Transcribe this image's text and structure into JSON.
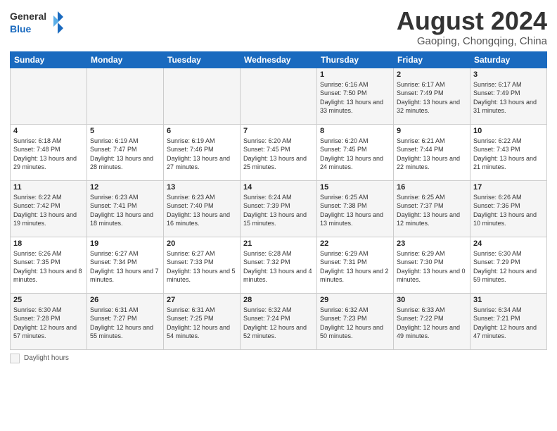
{
  "header": {
    "logo_general": "General",
    "logo_blue": "Blue",
    "month_title": "August 2024",
    "location": "Gaoping, Chongqing, China"
  },
  "days_of_week": [
    "Sunday",
    "Monday",
    "Tuesday",
    "Wednesday",
    "Thursday",
    "Friday",
    "Saturday"
  ],
  "legend": {
    "label": "Daylight hours"
  },
  "weeks": [
    [
      {
        "day": "",
        "info": ""
      },
      {
        "day": "",
        "info": ""
      },
      {
        "day": "",
        "info": ""
      },
      {
        "day": "",
        "info": ""
      },
      {
        "day": "1",
        "info": "Sunrise: 6:16 AM\nSunset: 7:50 PM\nDaylight: 13 hours\nand 33 minutes."
      },
      {
        "day": "2",
        "info": "Sunrise: 6:17 AM\nSunset: 7:49 PM\nDaylight: 13 hours\nand 32 minutes."
      },
      {
        "day": "3",
        "info": "Sunrise: 6:17 AM\nSunset: 7:49 PM\nDaylight: 13 hours\nand 31 minutes."
      }
    ],
    [
      {
        "day": "4",
        "info": "Sunrise: 6:18 AM\nSunset: 7:48 PM\nDaylight: 13 hours\nand 29 minutes."
      },
      {
        "day": "5",
        "info": "Sunrise: 6:19 AM\nSunset: 7:47 PM\nDaylight: 13 hours\nand 28 minutes."
      },
      {
        "day": "6",
        "info": "Sunrise: 6:19 AM\nSunset: 7:46 PM\nDaylight: 13 hours\nand 27 minutes."
      },
      {
        "day": "7",
        "info": "Sunrise: 6:20 AM\nSunset: 7:45 PM\nDaylight: 13 hours\nand 25 minutes."
      },
      {
        "day": "8",
        "info": "Sunrise: 6:20 AM\nSunset: 7:45 PM\nDaylight: 13 hours\nand 24 minutes."
      },
      {
        "day": "9",
        "info": "Sunrise: 6:21 AM\nSunset: 7:44 PM\nDaylight: 13 hours\nand 22 minutes."
      },
      {
        "day": "10",
        "info": "Sunrise: 6:22 AM\nSunset: 7:43 PM\nDaylight: 13 hours\nand 21 minutes."
      }
    ],
    [
      {
        "day": "11",
        "info": "Sunrise: 6:22 AM\nSunset: 7:42 PM\nDaylight: 13 hours\nand 19 minutes."
      },
      {
        "day": "12",
        "info": "Sunrise: 6:23 AM\nSunset: 7:41 PM\nDaylight: 13 hours\nand 18 minutes."
      },
      {
        "day": "13",
        "info": "Sunrise: 6:23 AM\nSunset: 7:40 PM\nDaylight: 13 hours\nand 16 minutes."
      },
      {
        "day": "14",
        "info": "Sunrise: 6:24 AM\nSunset: 7:39 PM\nDaylight: 13 hours\nand 15 minutes."
      },
      {
        "day": "15",
        "info": "Sunrise: 6:25 AM\nSunset: 7:38 PM\nDaylight: 13 hours\nand 13 minutes."
      },
      {
        "day": "16",
        "info": "Sunrise: 6:25 AM\nSunset: 7:37 PM\nDaylight: 13 hours\nand 12 minutes."
      },
      {
        "day": "17",
        "info": "Sunrise: 6:26 AM\nSunset: 7:36 PM\nDaylight: 13 hours\nand 10 minutes."
      }
    ],
    [
      {
        "day": "18",
        "info": "Sunrise: 6:26 AM\nSunset: 7:35 PM\nDaylight: 13 hours\nand 8 minutes."
      },
      {
        "day": "19",
        "info": "Sunrise: 6:27 AM\nSunset: 7:34 PM\nDaylight: 13 hours\nand 7 minutes."
      },
      {
        "day": "20",
        "info": "Sunrise: 6:27 AM\nSunset: 7:33 PM\nDaylight: 13 hours\nand 5 minutes."
      },
      {
        "day": "21",
        "info": "Sunrise: 6:28 AM\nSunset: 7:32 PM\nDaylight: 13 hours\nand 4 minutes."
      },
      {
        "day": "22",
        "info": "Sunrise: 6:29 AM\nSunset: 7:31 PM\nDaylight: 13 hours\nand 2 minutes."
      },
      {
        "day": "23",
        "info": "Sunrise: 6:29 AM\nSunset: 7:30 PM\nDaylight: 13 hours\nand 0 minutes."
      },
      {
        "day": "24",
        "info": "Sunrise: 6:30 AM\nSunset: 7:29 PM\nDaylight: 12 hours\nand 59 minutes."
      }
    ],
    [
      {
        "day": "25",
        "info": "Sunrise: 6:30 AM\nSunset: 7:28 PM\nDaylight: 12 hours\nand 57 minutes."
      },
      {
        "day": "26",
        "info": "Sunrise: 6:31 AM\nSunset: 7:27 PM\nDaylight: 12 hours\nand 55 minutes."
      },
      {
        "day": "27",
        "info": "Sunrise: 6:31 AM\nSunset: 7:25 PM\nDaylight: 12 hours\nand 54 minutes."
      },
      {
        "day": "28",
        "info": "Sunrise: 6:32 AM\nSunset: 7:24 PM\nDaylight: 12 hours\nand 52 minutes."
      },
      {
        "day": "29",
        "info": "Sunrise: 6:32 AM\nSunset: 7:23 PM\nDaylight: 12 hours\nand 50 minutes."
      },
      {
        "day": "30",
        "info": "Sunrise: 6:33 AM\nSunset: 7:22 PM\nDaylight: 12 hours\nand 49 minutes."
      },
      {
        "day": "31",
        "info": "Sunrise: 6:34 AM\nSunset: 7:21 PM\nDaylight: 12 hours\nand 47 minutes."
      }
    ]
  ]
}
